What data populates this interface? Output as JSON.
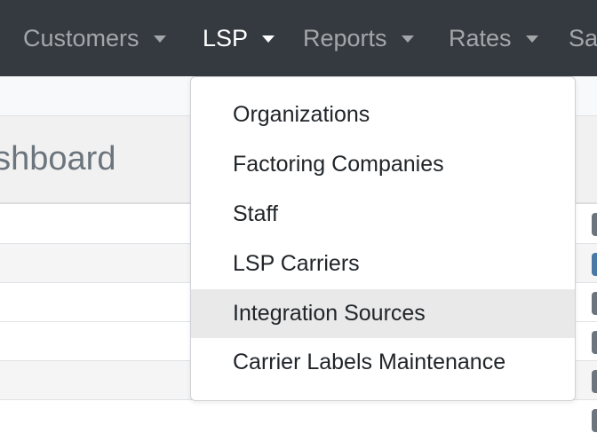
{
  "navbar": {
    "items": [
      {
        "label": "Customers",
        "has_caret": true,
        "active": false
      },
      {
        "label": "LSP",
        "has_caret": true,
        "active": true
      },
      {
        "label": "Reports",
        "has_caret": true,
        "active": false
      },
      {
        "label": "Rates",
        "has_caret": true,
        "active": false
      },
      {
        "label": "Sa",
        "has_caret": false,
        "active": false
      }
    ]
  },
  "card": {
    "title": "ashboard"
  },
  "dropdown": {
    "open_menu": "LSP",
    "items": [
      {
        "label": "Organizations"
      },
      {
        "label": "Factoring Companies"
      },
      {
        "label": "Staff"
      },
      {
        "label": "LSP Carriers"
      },
      {
        "label": "Integration Sources",
        "highlighted": true
      },
      {
        "label": "Carrier Labels Maintenance"
      }
    ]
  },
  "colors": {
    "navbar_bg": "#343a40",
    "nav_text": "rgba(255,255,255,0.55)",
    "nav_active_text": "#ffffff",
    "dropdown_hover_bg": "#e9e9e9",
    "row_button_gray": "#6c757d",
    "row_button_blue": "#4a79a6"
  }
}
